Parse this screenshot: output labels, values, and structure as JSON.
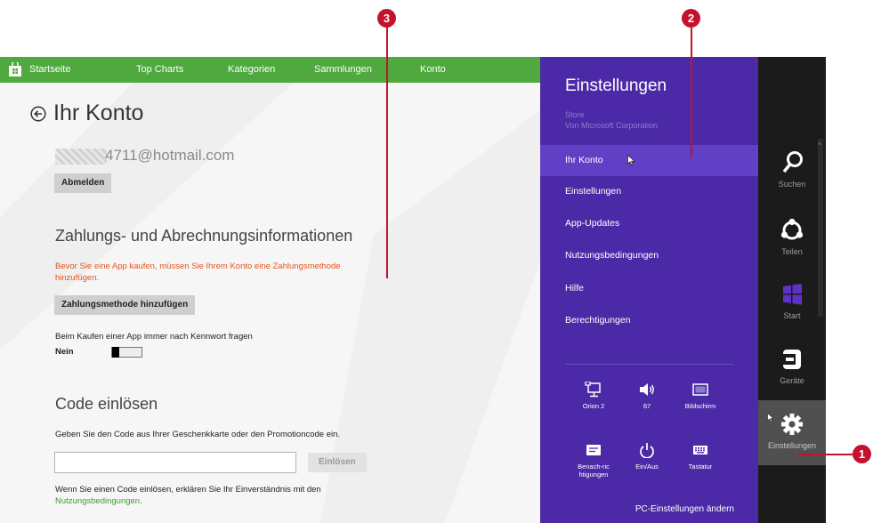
{
  "store": {
    "nav": [
      "Startseite",
      "Top Charts",
      "Kategorien",
      "Sammlungen",
      "Konto"
    ],
    "page_title": "Ihr Konto",
    "email": "4711@hotmail.com",
    "signout_button": "Abmelden",
    "payment_heading": "Zahlungs- und Abrechnungsinformationen",
    "payment_warning": "Bevor Sie eine App kaufen, müssen Sie Ihrem Konto eine Zahlungsmethode hinzufügen.",
    "add_payment_button": "Zahlungsmethode hinzufügen",
    "password_prompt_label": "Beim Kaufen einer App immer nach Kennwort fragen",
    "password_prompt_value": "Nein",
    "code_heading": "Code einlösen",
    "code_description": "Geben Sie den Code aus Ihrer Geschenkkarte oder den Promotioncode ein.",
    "code_input_value": "",
    "redeem_button": "Einlösen",
    "redeem_note": "Wenn Sie einen Code einlösen, erklären Sie Ihr Einverständnis mit den",
    "redeem_link": "Nutzungsbedingungen."
  },
  "settings": {
    "title": "Einstellungen",
    "app_name": "Store",
    "publisher": "Von Microsoft Corporation",
    "items": [
      "Ihr Konto",
      "Einstellungen",
      "App-Updates",
      "Nutzungsbedingungen",
      "Hilfe",
      "Berechtigungen"
    ],
    "quick_actions": [
      {
        "label": "Orion 2",
        "icon": "network-icon"
      },
      {
        "label": "67",
        "icon": "volume-icon"
      },
      {
        "label": "Bildschirm",
        "icon": "screen-icon"
      },
      {
        "label": "Benach-richtigungen",
        "icon": "notifications-icon"
      },
      {
        "label": "Ein/Aus",
        "icon": "power-icon"
      },
      {
        "label": "Tastatur",
        "icon": "keyboard-icon"
      }
    ],
    "pc_settings_link": "PC-Einstellungen ändern"
  },
  "charms": [
    {
      "label": "Suchen",
      "icon": "search-icon"
    },
    {
      "label": "Teilen",
      "icon": "share-icon"
    },
    {
      "label": "Start",
      "icon": "windows-icon"
    },
    {
      "label": "Geräte",
      "icon": "devices-icon"
    },
    {
      "label": "Einstellungen",
      "icon": "gear-icon"
    }
  ],
  "callouts": [
    "1",
    "2",
    "3"
  ],
  "colors": {
    "store_nav": "#4fa93f",
    "settings_bg": "#4c2aa7",
    "settings_active": "#6240c6",
    "charms_bg": "#1b1b1b",
    "callout": "#c3122e",
    "warning_text": "#e2541c",
    "link": "#3e9e2f"
  }
}
